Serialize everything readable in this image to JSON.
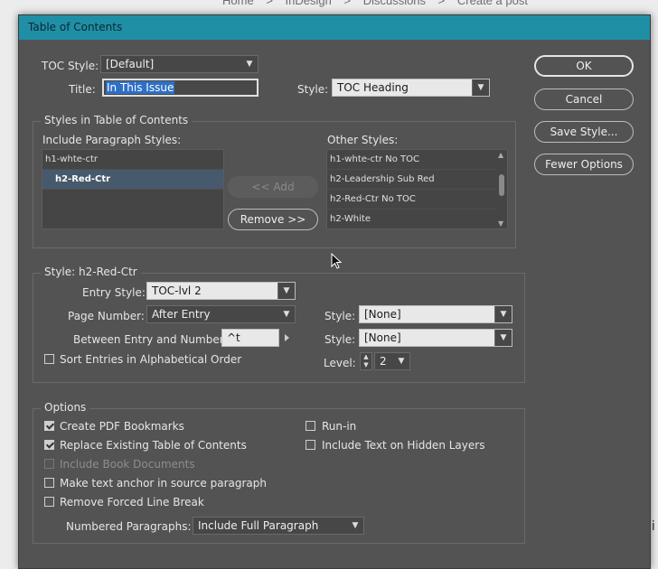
{
  "background": {
    "breadcrumbs": [
      "Home",
      ">",
      "InDesign",
      ">",
      "Discussions",
      ">",
      "Create a post"
    ],
    "side_text": "pi"
  },
  "dialog": {
    "title": "Table of Contents",
    "toc_style": {
      "label": "TOC Style:",
      "value": "[Default]"
    },
    "title_field": {
      "label": "Title:",
      "value": "In This Issue"
    },
    "title_style": {
      "label": "Style:",
      "value": "TOC Heading"
    },
    "buttons": {
      "ok": "OK",
      "cancel": "Cancel",
      "save_style": "Save Style...",
      "fewer_options": "Fewer Options"
    },
    "styles_group": {
      "title": "Styles in Table of Contents",
      "include_label": "Include Paragraph Styles:",
      "include_items": [
        "h1-whte-ctr",
        "h2-Red-Ctr"
      ],
      "selected_include": "h2-Red-Ctr",
      "add_label": "<< Add",
      "remove_label": "Remove >>",
      "other_label": "Other Styles:",
      "other_items": [
        "h1-whte-ctr No TOC",
        "h2-Leadership Sub Red",
        "h2-Red-Ctr No TOC",
        "h2-White"
      ]
    },
    "style_group": {
      "title": "Style: h2-Red-Ctr",
      "entry_style": {
        "label": "Entry Style:",
        "value": "TOC-lvl 2"
      },
      "page_number": {
        "label": "Page Number:",
        "value": "After Entry"
      },
      "page_number_style": {
        "label": "Style:",
        "value": "[None]"
      },
      "between": {
        "label": "Between Entry and Number:",
        "value": "^t"
      },
      "between_style": {
        "label": "Style:",
        "value": "[None]"
      },
      "sort_label": "Sort Entries in Alphabetical Order",
      "sort_checked": false,
      "level": {
        "label": "Level:",
        "value": "2"
      }
    },
    "options_group": {
      "title": "Options",
      "create_pdf_bookmarks": {
        "label": "Create PDF Bookmarks",
        "checked": true
      },
      "replace_existing": {
        "label": "Replace Existing Table of Contents",
        "checked": true
      },
      "include_book_docs": {
        "label": "Include Book Documents",
        "checked": false,
        "disabled": true
      },
      "make_text_anchor": {
        "label": "Make text anchor in source paragraph",
        "checked": false
      },
      "remove_forced_line_break": {
        "label": "Remove Forced Line Break",
        "checked": false
      },
      "run_in": {
        "label": "Run-in",
        "checked": false
      },
      "include_hidden_layers": {
        "label": "Include Text on Hidden Layers",
        "checked": false
      },
      "numbered_paragraphs": {
        "label": "Numbered Paragraphs:",
        "value": "Include Full Paragraph"
      }
    }
  },
  "colors": {
    "titlebar": "#1f8fa6",
    "dialog_bg": "#535353",
    "selection": "#2f6fc6"
  }
}
